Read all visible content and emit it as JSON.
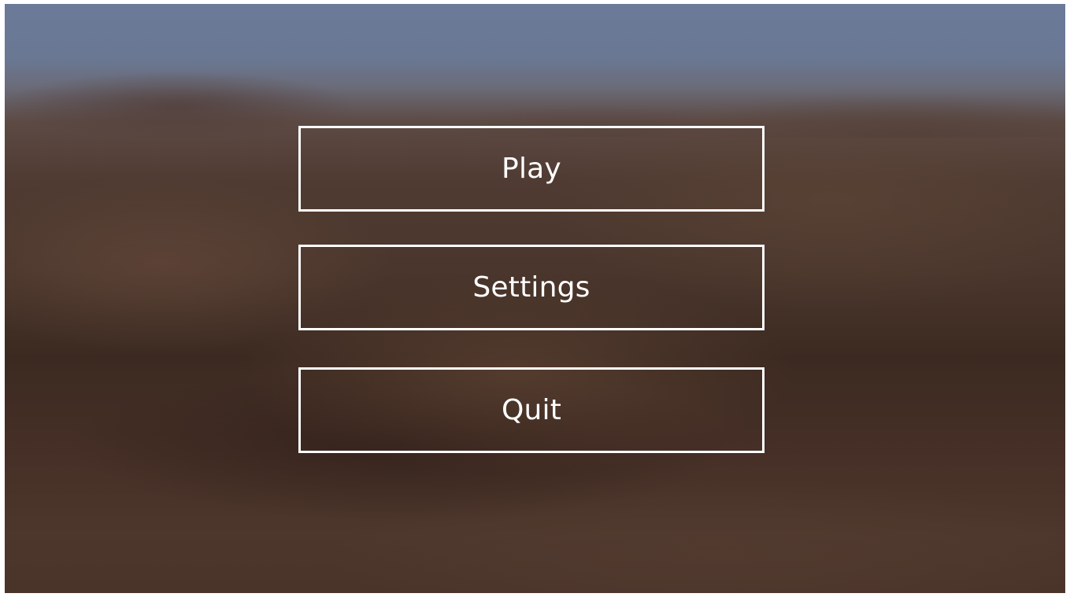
{
  "main_menu": {
    "buttons": [
      {
        "label": "Play"
      },
      {
        "label": "Settings"
      },
      {
        "label": "Quit"
      }
    ]
  },
  "colors": {
    "button_border": "#ffffff",
    "button_text": "#ffffff",
    "sky": "#6a7a98",
    "terrain": "#4a362c"
  }
}
